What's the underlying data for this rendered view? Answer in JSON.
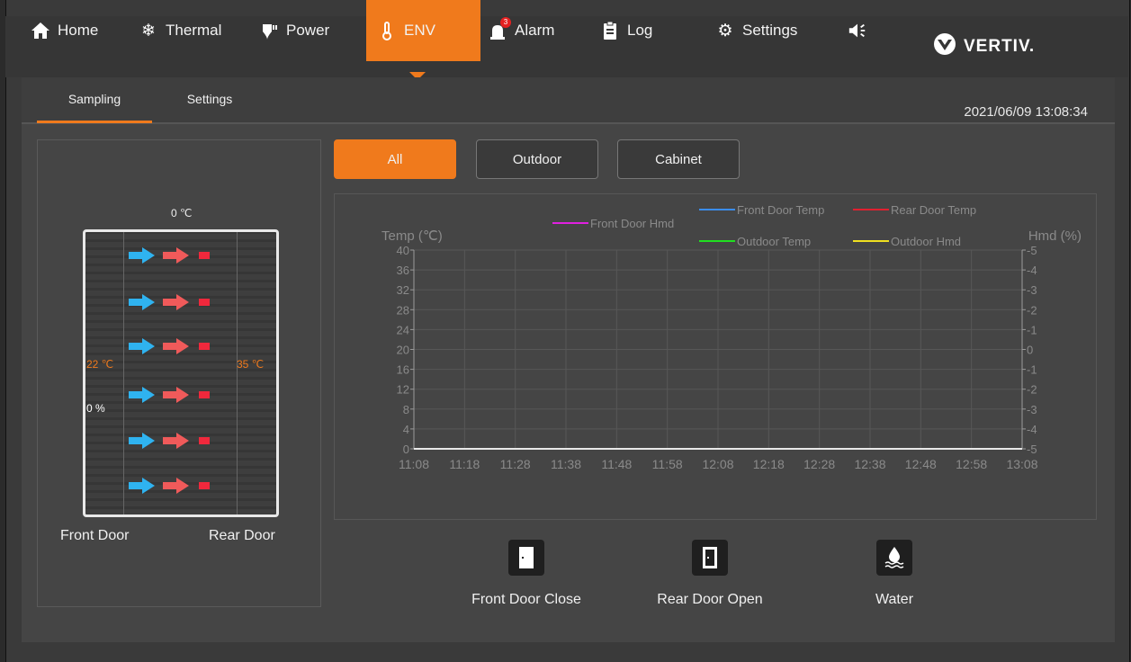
{
  "nav": {
    "items": [
      {
        "label": "Home",
        "icon": "home-icon"
      },
      {
        "label": "Thermal",
        "icon": "snowflake-icon"
      },
      {
        "label": "Power",
        "icon": "plug-icon"
      },
      {
        "label": "ENV",
        "icon": "thermometer-icon"
      },
      {
        "label": "Alarm",
        "icon": "alarm-icon",
        "badge": "3"
      },
      {
        "label": "Log",
        "icon": "clipboard-icon"
      },
      {
        "label": "Settings",
        "icon": "gear-icon"
      }
    ],
    "active": "ENV",
    "accent_color": "#f07a1c",
    "logo_text": "VERTIV."
  },
  "subnav": {
    "tabs": [
      "Sampling",
      "Settings"
    ],
    "active": "Sampling",
    "datetime": "2021/06/09 13:08:34"
  },
  "cabinet": {
    "top_temp": "0 ℃",
    "front_temp": "22 ℃",
    "rear_temp": "35 ℃",
    "front_hmd": "0 %",
    "front_label": "Front Door",
    "rear_label": "Rear Door"
  },
  "filters": {
    "buttons": [
      "All",
      "Outdoor",
      "Cabinet"
    ],
    "active": "All"
  },
  "chart_data": {
    "type": "line",
    "ylabel": "Temp (℃)",
    "y2label": "Hmd (%)",
    "ylim": [
      0,
      40
    ],
    "y2lim": [
      -5,
      5
    ],
    "yticks": [
      0,
      4,
      8,
      12,
      16,
      20,
      24,
      28,
      32,
      36,
      40
    ],
    "y2ticks": [
      -5,
      -4,
      -3,
      -2,
      -1,
      0,
      1,
      2,
      3,
      4,
      5
    ],
    "y2tick_labels": [
      "-5",
      "-4",
      "-3",
      "-2",
      "-1",
      "0",
      "-1",
      "-2",
      "-3",
      "-4",
      "-5"
    ],
    "xticks": [
      "11:08",
      "11:18",
      "11:28",
      "11:38",
      "11:48",
      "11:58",
      "12:08",
      "12:18",
      "12:28",
      "12:38",
      "12:48",
      "12:58",
      "13:08"
    ],
    "grid": true,
    "legend_position": "top",
    "series": [
      {
        "name": "Front Door Hmd",
        "color": "#e020e0",
        "values": [
          0,
          0,
          0,
          0,
          0,
          0,
          0,
          0,
          0,
          0,
          0,
          0,
          0
        ]
      },
      {
        "name": "Front Door Temp",
        "color": "#3a8df0",
        "values": [
          0,
          0,
          0,
          0,
          0,
          0,
          0,
          0,
          0,
          0,
          0,
          0,
          0
        ]
      },
      {
        "name": "Rear Door Temp",
        "color": "#e02030",
        "values": [
          0,
          0,
          0,
          0,
          0,
          0,
          0,
          0,
          0,
          0,
          0,
          0,
          0
        ]
      },
      {
        "name": "Outdoor Temp",
        "color": "#20e020",
        "values": [
          0,
          0,
          0,
          0,
          0,
          0,
          0,
          0,
          0,
          0,
          0,
          0,
          0
        ]
      },
      {
        "name": "Outdoor Hmd",
        "color": "#f0e020",
        "values": [
          0,
          0,
          0,
          0,
          0,
          0,
          0,
          0,
          0,
          0,
          0,
          0,
          0
        ]
      }
    ]
  },
  "status": [
    {
      "label": "Front Door Close",
      "icon": "door-closed-icon"
    },
    {
      "label": "Rear Door Open",
      "icon": "door-open-icon"
    },
    {
      "label": "Water",
      "icon": "water-icon"
    }
  ]
}
